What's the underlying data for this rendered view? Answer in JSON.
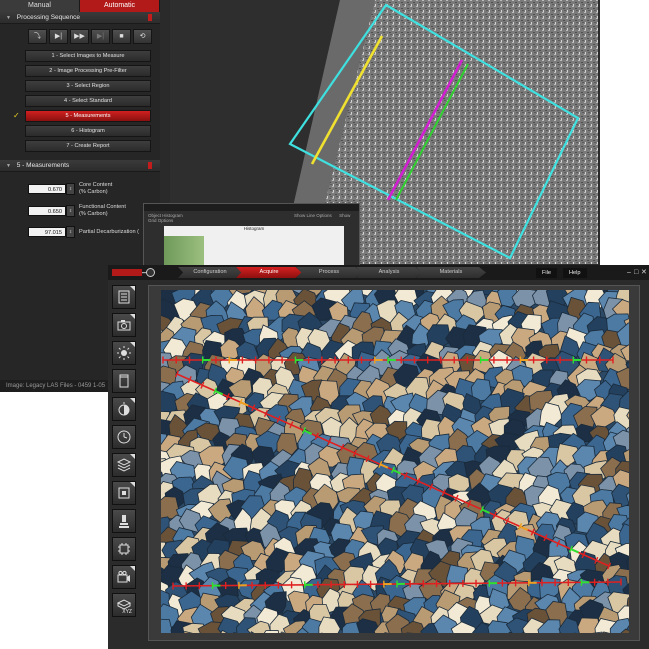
{
  "back_window": {
    "mode_tabs": [
      "Manual",
      "Automatic"
    ],
    "processing": {
      "title": "Processing Sequence",
      "buttons": [
        "step-into",
        "step",
        "run",
        "run-to",
        "stop",
        "reset"
      ],
      "steps": [
        "1 - Select Images to Measure",
        "2 - Image Processing Pre-Filter",
        "3 - Select Region",
        "4 - Select Standard",
        "5 - Measurements",
        "6 - Histogram",
        "7 - Create Report"
      ],
      "active_step": 4
    },
    "measurements": {
      "title": "5 - Measurements",
      "rows": [
        {
          "value": "0.670",
          "label_1": "Core Content",
          "label_2": "(% Carbon)"
        },
        {
          "value": "0.650",
          "label_1": "Functional Content",
          "label_2": "(% Carbon)"
        },
        {
          "value": "97.015",
          "label_1": "Partial Decarburization (",
          "label_2": ""
        }
      ]
    },
    "status": "Image: Legacy LAS Files - 0459 1-05",
    "mini_window": {
      "tab_label": "Object Histogram",
      "chart_title": "Histogram",
      "options": [
        "Show Line Options",
        "Show Grid Options"
      ]
    }
  },
  "front_window": {
    "workflow_tabs": [
      "Configuration",
      "Acquire",
      "Process",
      "Analysis",
      "Materials"
    ],
    "active_tab": 1,
    "menu": [
      "File",
      "Help"
    ],
    "tools": [
      "list-icon",
      "camera-icon",
      "brightness-icon",
      "cylinder-icon",
      "exposure-icon",
      "clock-icon",
      "layers-icon",
      "focus-icon",
      "microscope-icon",
      "chip-icon",
      "video-camera-icon",
      "xyz-stage-icon"
    ],
    "xyz_label": "XYZ"
  },
  "colors": {
    "accent_red": "#b21a1a",
    "overlay_cyan": "#3fe0e0",
    "overlay_yellow": "#f0e030",
    "overlay_magenta": "#d020d0",
    "overlay_green": "#30d030",
    "measure_red": "#e02020",
    "measure_green": "#30e030",
    "measure_orange": "#f0a020"
  }
}
